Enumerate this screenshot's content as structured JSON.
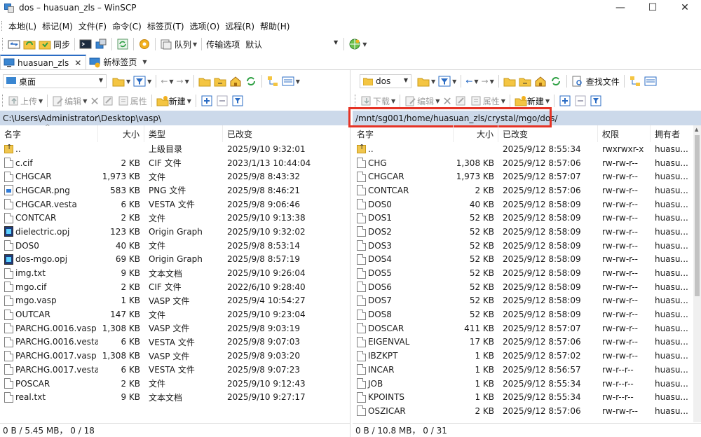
{
  "window": {
    "title": "dos – huasuan_zls – WinSCP",
    "minimize": "—",
    "maximize": "☐",
    "close": "✕"
  },
  "menu": [
    "本地(L)",
    "标记(M)",
    "文件(F)",
    "命令(C)",
    "标签页(T)",
    "选项(O)",
    "远程(R)",
    "帮助(H)"
  ],
  "toolbar_main": {
    "sync_label": "同步",
    "queue_label": "队列",
    "transfer_label": "传输选项",
    "transfer_value": "默认"
  },
  "tabs": {
    "session_label": "huasuan_zls",
    "close": "✕",
    "new_tab_label": "新标签页"
  },
  "left_panel": {
    "location": "桌面",
    "upload": "上传",
    "edit": "编辑",
    "properties": "属性",
    "new": "新建",
    "path": "C:\\Users\\Administrator\\Desktop\\vasp\\",
    "columns": {
      "name": "名字",
      "size": "大小",
      "type": "类型",
      "modified": "已改变"
    },
    "files": [
      {
        "icon": "up",
        "name": "..",
        "size": "",
        "type": "上级目录",
        "modified": "2025/9/10 9:32:01"
      },
      {
        "icon": "doc",
        "name": "c.cif",
        "size": "2 KB",
        "type": "CIF 文件",
        "modified": "2023/1/13 10:44:04"
      },
      {
        "icon": "doc",
        "name": "CHGCAR",
        "size": "1,973 KB",
        "type": "文件",
        "modified": "2025/9/8 8:43:32"
      },
      {
        "icon": "png",
        "name": "CHGCAR.png",
        "size": "583 KB",
        "type": "PNG 文件",
        "modified": "2025/9/8 8:46:21"
      },
      {
        "icon": "doc",
        "name": "CHGCAR.vesta",
        "size": "6 KB",
        "type": "VESTA 文件",
        "modified": "2025/9/8 9:06:46"
      },
      {
        "icon": "doc",
        "name": "CONTCAR",
        "size": "2 KB",
        "type": "文件",
        "modified": "2025/9/10 9:13:38"
      },
      {
        "icon": "opj",
        "name": "dielectric.opj",
        "size": "123 KB",
        "type": "Origin Graph",
        "modified": "2025/9/10 9:32:02"
      },
      {
        "icon": "doc",
        "name": "DOS0",
        "size": "40 KB",
        "type": "文件",
        "modified": "2025/9/8 8:53:14"
      },
      {
        "icon": "opj",
        "name": "dos-mgo.opj",
        "size": "69 KB",
        "type": "Origin Graph",
        "modified": "2025/9/8 8:57:19"
      },
      {
        "icon": "doc",
        "name": "img.txt",
        "size": "9 KB",
        "type": "文本文档",
        "modified": "2025/9/10 9:26:04"
      },
      {
        "icon": "doc",
        "name": "mgo.cif",
        "size": "2 KB",
        "type": "CIF 文件",
        "modified": "2022/6/10 9:28:40"
      },
      {
        "icon": "doc",
        "name": "mgo.vasp",
        "size": "1 KB",
        "type": "VASP 文件",
        "modified": "2025/9/4 10:54:27"
      },
      {
        "icon": "doc",
        "name": "OUTCAR",
        "size": "147 KB",
        "type": "文件",
        "modified": "2025/9/10 9:23:04"
      },
      {
        "icon": "doc",
        "name": "PARCHG.0016.vasp",
        "size": "1,308 KB",
        "type": "VASP 文件",
        "modified": "2025/9/8 9:03:19"
      },
      {
        "icon": "doc",
        "name": "PARCHG.0016.vesta",
        "size": "6 KB",
        "type": "VESTA 文件",
        "modified": "2025/9/8 9:07:03"
      },
      {
        "icon": "doc",
        "name": "PARCHG.0017.vasp",
        "size": "1,308 KB",
        "type": "VASP 文件",
        "modified": "2025/9/8 9:03:20"
      },
      {
        "icon": "doc",
        "name": "PARCHG.0017.vesta",
        "size": "6 KB",
        "type": "VESTA 文件",
        "modified": "2025/9/8 9:07:23"
      },
      {
        "icon": "doc",
        "name": "POSCAR",
        "size": "2 KB",
        "type": "文件",
        "modified": "2025/9/10 9:12:43"
      },
      {
        "icon": "doc",
        "name": "real.txt",
        "size": "9 KB",
        "type": "文本文档",
        "modified": "2025/9/10 9:27:17"
      }
    ],
    "status": "0 B / 5.45 MB，  0 / 18"
  },
  "right_panel": {
    "location": "dos",
    "download": "下载",
    "edit": "编辑",
    "properties": "属性",
    "new": "新建",
    "find_files": "查找文件",
    "path": "/mnt/sg001/home/huasuan_zls/crystal/mgo/dos/",
    "columns": {
      "name": "名字",
      "size": "大小",
      "modified": "已改变",
      "rights": "权限",
      "owner": "拥有者"
    },
    "files": [
      {
        "icon": "up",
        "name": "..",
        "size": "",
        "modified": "2025/9/12 8:55:34",
        "rights": "rwxrwxr-x",
        "owner": "huasu..."
      },
      {
        "icon": "doc",
        "name": "CHG",
        "size": "1,308 KB",
        "modified": "2025/9/12 8:57:06",
        "rights": "rw-rw-r--",
        "owner": "huasu..."
      },
      {
        "icon": "doc",
        "name": "CHGCAR",
        "size": "1,973 KB",
        "modified": "2025/9/12 8:57:07",
        "rights": "rw-rw-r--",
        "owner": "huasu..."
      },
      {
        "icon": "doc",
        "name": "CONTCAR",
        "size": "2 KB",
        "modified": "2025/9/12 8:57:06",
        "rights": "rw-rw-r--",
        "owner": "huasu..."
      },
      {
        "icon": "doc",
        "name": "DOS0",
        "size": "40 KB",
        "modified": "2025/9/12 8:58:09",
        "rights": "rw-rw-r--",
        "owner": "huasu..."
      },
      {
        "icon": "doc",
        "name": "DOS1",
        "size": "52 KB",
        "modified": "2025/9/12 8:58:09",
        "rights": "rw-rw-r--",
        "owner": "huasu..."
      },
      {
        "icon": "doc",
        "name": "DOS2",
        "size": "52 KB",
        "modified": "2025/9/12 8:58:09",
        "rights": "rw-rw-r--",
        "owner": "huasu..."
      },
      {
        "icon": "doc",
        "name": "DOS3",
        "size": "52 KB",
        "modified": "2025/9/12 8:58:09",
        "rights": "rw-rw-r--",
        "owner": "huasu..."
      },
      {
        "icon": "doc",
        "name": "DOS4",
        "size": "52 KB",
        "modified": "2025/9/12 8:58:09",
        "rights": "rw-rw-r--",
        "owner": "huasu..."
      },
      {
        "icon": "doc",
        "name": "DOS5",
        "size": "52 KB",
        "modified": "2025/9/12 8:58:09",
        "rights": "rw-rw-r--",
        "owner": "huasu..."
      },
      {
        "icon": "doc",
        "name": "DOS6",
        "size": "52 KB",
        "modified": "2025/9/12 8:58:09",
        "rights": "rw-rw-r--",
        "owner": "huasu..."
      },
      {
        "icon": "doc",
        "name": "DOS7",
        "size": "52 KB",
        "modified": "2025/9/12 8:58:09",
        "rights": "rw-rw-r--",
        "owner": "huasu..."
      },
      {
        "icon": "doc",
        "name": "DOS8",
        "size": "52 KB",
        "modified": "2025/9/12 8:58:09",
        "rights": "rw-rw-r--",
        "owner": "huasu..."
      },
      {
        "icon": "doc",
        "name": "DOSCAR",
        "size": "411 KB",
        "modified": "2025/9/12 8:57:07",
        "rights": "rw-rw-r--",
        "owner": "huasu..."
      },
      {
        "icon": "doc",
        "name": "EIGENVAL",
        "size": "17 KB",
        "modified": "2025/9/12 8:57:06",
        "rights": "rw-rw-r--",
        "owner": "huasu..."
      },
      {
        "icon": "doc",
        "name": "IBZKPT",
        "size": "1 KB",
        "modified": "2025/9/12 8:57:02",
        "rights": "rw-rw-r--",
        "owner": "huasu..."
      },
      {
        "icon": "doc",
        "name": "INCAR",
        "size": "1 KB",
        "modified": "2025/9/12 8:56:57",
        "rights": "rw-r--r--",
        "owner": "huasu..."
      },
      {
        "icon": "doc",
        "name": "JOB",
        "size": "1 KB",
        "modified": "2025/9/12 8:55:34",
        "rights": "rw-r--r--",
        "owner": "huasu..."
      },
      {
        "icon": "doc",
        "name": "KPOINTS",
        "size": "1 KB",
        "modified": "2025/9/12 8:55:34",
        "rights": "rw-r--r--",
        "owner": "huasu..."
      },
      {
        "icon": "doc",
        "name": "OSZICAR",
        "size": "2 KB",
        "modified": "2025/9/12 8:57:06",
        "rights": "rw-rw-r--",
        "owner": "huasu..."
      }
    ],
    "status": "0 B / 10.8 MB，  0 / 31"
  },
  "colors": {
    "path_bar": "#ccd9ea",
    "highlight": "#e53325",
    "active_tab_accent": "#2b6cc4"
  }
}
